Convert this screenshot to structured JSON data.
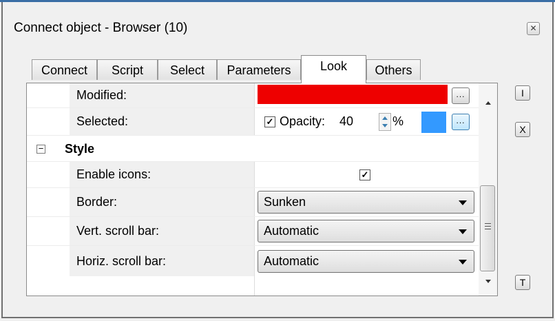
{
  "window": {
    "title": "Connect object - Browser (10)"
  },
  "tabs": [
    {
      "label": "Connect"
    },
    {
      "label": "Script"
    },
    {
      "label": "Select"
    },
    {
      "label": "Parameters"
    },
    {
      "label": "Look",
      "active": true
    },
    {
      "label": "Others"
    }
  ],
  "properties": {
    "modified": {
      "label": "Modified:",
      "color": "#ee0000",
      "button": "..."
    },
    "selected": {
      "label": "Selected:",
      "checked": true,
      "opacity_label": "Opacity:",
      "opacity_value": "40",
      "unit": "%",
      "color": "#3399ff",
      "button": "..."
    },
    "style_section": {
      "label": "Style",
      "expander": "−"
    },
    "enable_icons": {
      "label": "Enable icons:",
      "checked": true
    },
    "border": {
      "label": "Border:",
      "value": "Sunken"
    },
    "vert_scroll": {
      "label": "Vert. scroll bar:",
      "value": "Automatic"
    },
    "horiz_scroll": {
      "label": "Horiz. scroll bar:",
      "value": "Automatic"
    }
  },
  "side_buttons": {
    "i": "I",
    "x": "X",
    "t": "T"
  },
  "icons": {
    "close": "close-icon",
    "check": "checkmark-icon"
  }
}
